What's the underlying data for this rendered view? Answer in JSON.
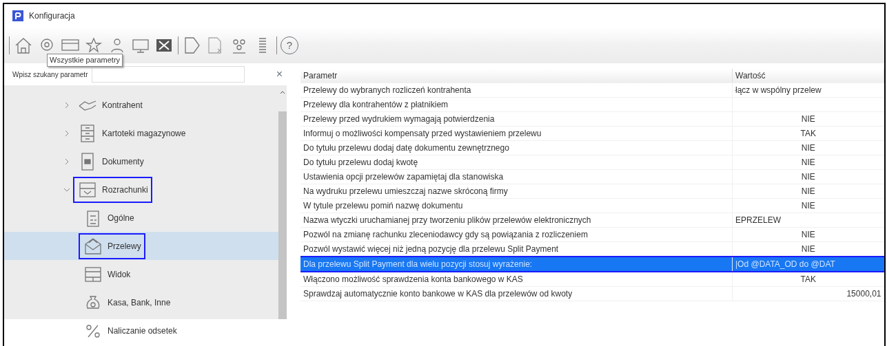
{
  "window": {
    "title": "Konfiguracja"
  },
  "toolbar": {
    "tooltip": "Wszystkie parametry",
    "help": "?"
  },
  "search": {
    "label": "Wpisz szukany parametr",
    "clear": "×"
  },
  "tree": [
    {
      "label": "Kontrahent",
      "expanded": false,
      "selected": false,
      "outlined": false
    },
    {
      "label": "Kartoteki magazynowe",
      "expanded": false,
      "selected": false,
      "outlined": false
    },
    {
      "label": "Dokumenty",
      "expanded": false,
      "selected": false,
      "outlined": false
    },
    {
      "label": "Rozrachunki",
      "expanded": true,
      "selected": false,
      "outlined": true,
      "children": [
        {
          "label": "Ogólne",
          "selected": false,
          "outlined": false
        },
        {
          "label": "Przelewy",
          "selected": true,
          "outlined": true
        },
        {
          "label": "Widok",
          "selected": false,
          "outlined": false
        },
        {
          "label": "Kasa, Bank, Inne",
          "selected": false,
          "outlined": false
        },
        {
          "label": "Naliczanie odsetek",
          "selected": false,
          "outlined": false
        }
      ]
    }
  ],
  "table": {
    "columns": [
      "Parametr",
      "Wartość"
    ],
    "rows": [
      {
        "name": "Przelewy do wybranych rozliczeń kontrahenta",
        "value": "łącz w wspólny przelew",
        "kind": "text",
        "selected": false
      },
      {
        "name": "Przelewy dla kontrahentów z płatnikiem",
        "value": "",
        "kind": "text",
        "selected": false
      },
      {
        "name": "Przelewy przed wydrukiem wymagają potwierdzenia",
        "value": "NIE",
        "kind": "flag",
        "selected": false
      },
      {
        "name": "Informuj o możliwości kompensaty przed wystawieniem przelewu",
        "value": "TAK",
        "kind": "flag",
        "selected": false
      },
      {
        "name": "Do tytułu przelewu dodaj datę dokumentu zewnętrznego",
        "value": "NIE",
        "kind": "flag",
        "selected": false
      },
      {
        "name": "Do tytułu przelewu dodaj kwotę",
        "value": "NIE",
        "kind": "flag",
        "selected": false
      },
      {
        "name": "Ustawienia opcji przelewów zapamiętaj dla stanowiska",
        "value": "NIE",
        "kind": "flag",
        "selected": false
      },
      {
        "name": "Na wydruku przelewu umieszczaj nazwe skróconą firmy",
        "value": "NIE",
        "kind": "flag",
        "selected": false
      },
      {
        "name": "W tytule przelewu pomiń nazwę dokumentu",
        "value": "NIE",
        "kind": "flag",
        "selected": false
      },
      {
        "name": "Nazwa wtyczki uruchamianej przy tworzeniu plików przelewów elektronicznych",
        "value": "EPRZELEW",
        "kind": "text",
        "selected": false
      },
      {
        "name": "Pozwól na zmianę rachunku zleceniodawcy gdy są powiązania z rozliczeniem",
        "value": "NIE",
        "kind": "flag",
        "selected": false
      },
      {
        "name": "Pozwól wystawić więcej niż jedną pozycję dla przelewu Split Payment",
        "value": "NIE",
        "kind": "flag",
        "selected": false
      },
      {
        "name": "Dla przelewu Split Payment dla wielu pozycji stosuj wyrażenie:",
        "value": "|Od @DATA_OD do @DAT",
        "kind": "text",
        "selected": true
      },
      {
        "name": "Włączono możliwość sprawdzenia konta bankowego w KAS",
        "value": "TAK",
        "kind": "flag",
        "selected": false
      },
      {
        "name": "Sprawdzaj automatycznie konto bankowe w KAS dla przelewów od kwoty",
        "value": "15000,01",
        "kind": "number",
        "selected": false
      }
    ]
  }
}
